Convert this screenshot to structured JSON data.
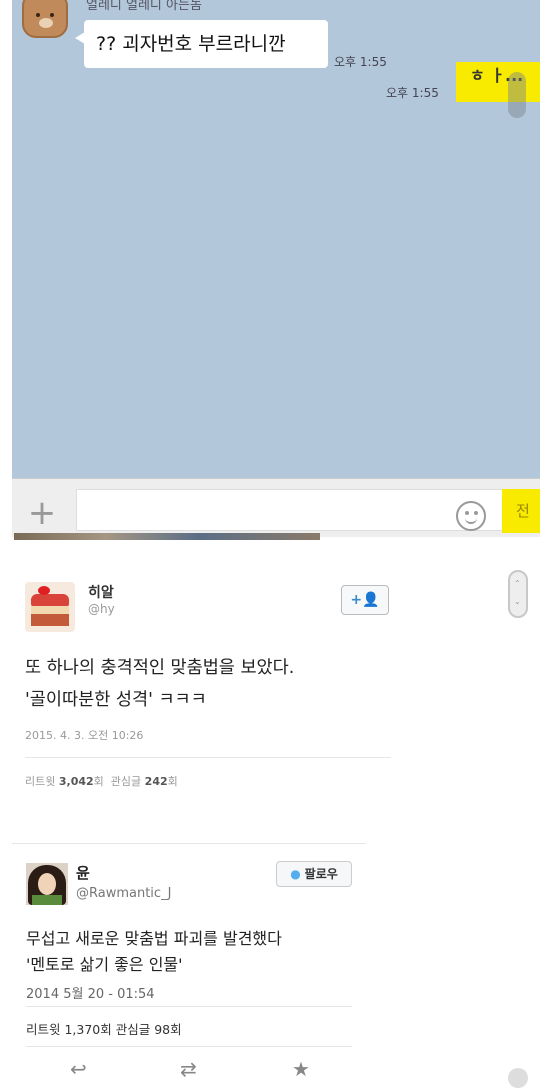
{
  "chat": {
    "sender_name": "얼레디 얼레디 아는놈",
    "incoming_message": "?? 괴자번호 부르라니깐",
    "incoming_time": "오후 1:55",
    "outgoing_time": "오후 1:55",
    "outgoing_message": "ㅎ ㅏ...",
    "plus_icon": "plus-icon",
    "emoji_icon": "smiley-icon",
    "send_label": "전송",
    "colors": {
      "background": "#b2c7d9",
      "outgoing_bubble": "#f9eb00",
      "incoming_bubble": "#ffffff"
    }
  },
  "tweet1": {
    "name": "히알",
    "handle": "@hy",
    "follow_icon": "add-user-icon",
    "follow_label": "+👤",
    "text_line1": "또 하나의 충격적인 맞춤법을 보았다.",
    "text_line2": "'골이따분한 성격' ㅋㅋㅋ",
    "date": "2015. 4. 3. 오전 10:26",
    "retweet_label": "리트윗",
    "retweet_count": "3,042",
    "retweet_unit": "회",
    "fav_label": "관심글",
    "fav_count": "242",
    "fav_unit": "회"
  },
  "tweet2": {
    "name": "윤",
    "handle": "@Rawmantic_J",
    "follow_label": "팔로우",
    "text_line1": "무섭고 새로운 맞춤법 파괴를 발견했다",
    "text_line2": "'멘토로 삶기 좋은 인물'",
    "date": "2014 5월 20 - 01:54",
    "stats": "리트윗 1,370회 관심글 98회",
    "actions": {
      "reply": "↩",
      "retweet": "⇄",
      "favorite": "★"
    }
  }
}
